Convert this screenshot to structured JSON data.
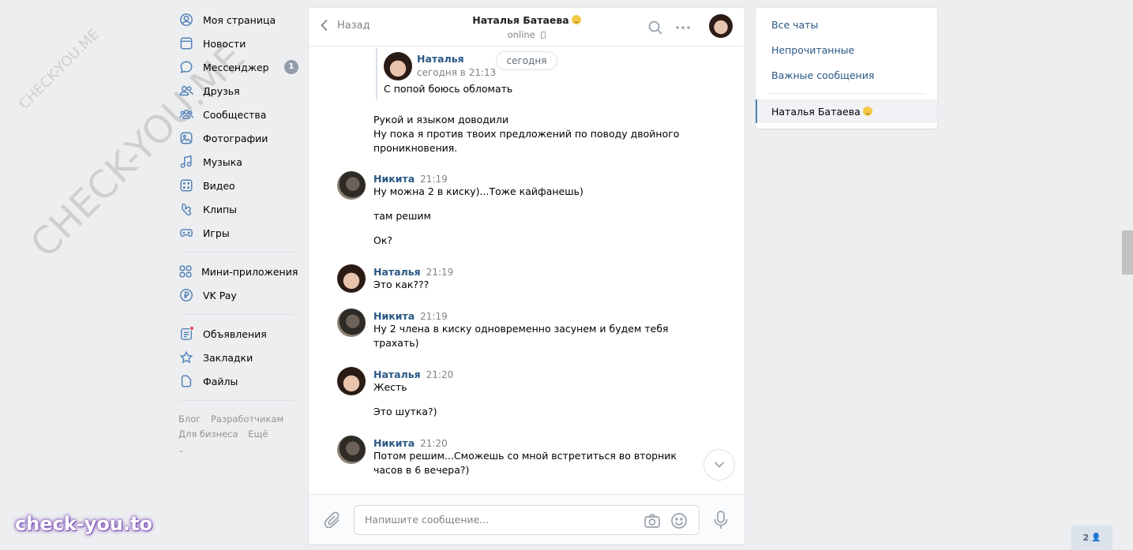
{
  "sidebar": {
    "items": [
      {
        "label": "Моя страница",
        "icon": "user-circle-icon"
      },
      {
        "label": "Новости",
        "icon": "news-icon"
      },
      {
        "label": "Мессенджер",
        "icon": "chat-bubble-icon",
        "badge": "1"
      },
      {
        "label": "Друзья",
        "icon": "friends-icon"
      },
      {
        "label": "Сообщества",
        "icon": "communities-icon"
      },
      {
        "label": "Фотографии",
        "icon": "photo-icon"
      },
      {
        "label": "Музыка",
        "icon": "music-icon"
      },
      {
        "label": "Видео",
        "icon": "video-icon"
      },
      {
        "label": "Клипы",
        "icon": "clips-icon"
      },
      {
        "label": "Игры",
        "icon": "gamepad-icon"
      }
    ],
    "items2": [
      {
        "label": "Мини-приложения",
        "icon": "apps-icon"
      },
      {
        "label": "VK Pay",
        "icon": "vkpay-icon"
      }
    ],
    "items3": [
      {
        "label": "Объявления",
        "icon": "ads-icon"
      },
      {
        "label": "Закладки",
        "icon": "star-icon"
      },
      {
        "label": "Файлы",
        "icon": "file-icon"
      }
    ],
    "footer": [
      "Блог",
      "Разработчикам",
      "Для бизнеса",
      "Ещё"
    ]
  },
  "chat": {
    "back_label": "Назад",
    "title": "Наталья Батаева",
    "status": "online",
    "forwarded": {
      "author": "Наталья",
      "time": "сегодня в 21:13",
      "text": "С попой боюсь обломать"
    },
    "date_pill": "сегодня",
    "continuation": [
      "Рукой и языком доводили",
      "Ну пока я против твоих предложений по поводу двойного",
      "проникновения."
    ],
    "messages": [
      {
        "author": "Никита",
        "time": "21:19",
        "lines": [
          "Ну можна 2 в киску)...Тоже кайфанешь)"
        ],
        "extra": [
          "там решим",
          "Ок?"
        ]
      },
      {
        "author": "Наталья",
        "time": "21:19",
        "lines": [
          "Это как???"
        ],
        "extra": []
      },
      {
        "author": "Никита",
        "time": "21:19",
        "lines": [
          "Ну 2 члена в киску одновременно засунем и будем тебя",
          "трахать)"
        ],
        "extra": []
      },
      {
        "author": "Наталья",
        "time": "21:20",
        "lines": [
          "Жесть"
        ],
        "extra": [
          "Это шутка?)"
        ]
      },
      {
        "author": "Никита",
        "time": "21:20",
        "lines": [
          "Потом решим...Сможешь со мной встретиться во вторник",
          "часов в 6 вечера?)"
        ],
        "extra": []
      }
    ],
    "input_placeholder": "Напишите сообщение..."
  },
  "right_panel": {
    "links": [
      "Все чаты",
      "Непрочитанные",
      "Важные сообщения"
    ],
    "active_chat": "Наталья Батаева"
  },
  "watermark": {
    "small": "CHECK-YOU.ME",
    "large": "CHECK-YOU.ME",
    "brand": "check-you.to"
  },
  "online_widget": "2",
  "colors": {
    "accent": "#5181b8",
    "link": "#2a5885",
    "bg": "#edeef0"
  }
}
